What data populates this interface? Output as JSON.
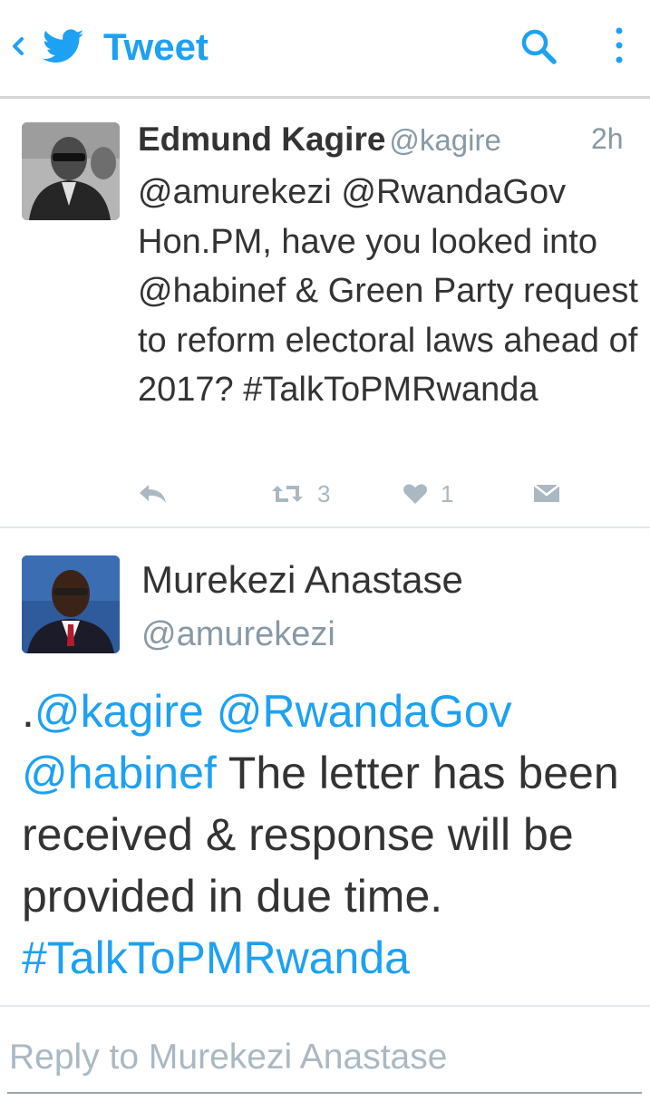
{
  "header": {
    "title": "Tweet",
    "accent_color": "#1da1f2",
    "icons": [
      "chevron-left-icon",
      "twitter-bird-icon",
      "search-icon",
      "more-vertical-icon"
    ]
  },
  "tweet1": {
    "name": "Edmund Kagire",
    "handle": "@kagire",
    "time": "2h",
    "text_segments": [
      {
        "text": "@amurekezi ",
        "link": false
      },
      {
        "text": "@RwandaGov",
        "link": false
      },
      {
        "text": " Hon.PM, have you looked into ",
        "link": false
      },
      {
        "text": "@habinef",
        "link": false
      },
      {
        "text": " & Green Party request to reform electoral laws ahead of 2017? ",
        "link": false
      },
      {
        "text": "#TalkToPMRwanda",
        "link": false
      }
    ],
    "retweet_count": "3",
    "like_count": "1"
  },
  "tweet2": {
    "name": "Murekezi Anastase",
    "handle": "@amurekezi",
    "text_segments": [
      {
        "text": ".",
        "link": false
      },
      {
        "text": "@kagire",
        "link": true
      },
      {
        "text": " ",
        "link": false
      },
      {
        "text": "@RwandaGov",
        "link": true
      },
      {
        "text": " ",
        "link": false
      },
      {
        "text": "@habinef",
        "link": true
      },
      {
        "text": " The letter has been received & response will be provided in due time. ",
        "link": false
      },
      {
        "text": "#TalkToPMRwanda",
        "link": true
      }
    ]
  },
  "reply": {
    "placeholder": "Reply to Murekezi Anastase"
  }
}
